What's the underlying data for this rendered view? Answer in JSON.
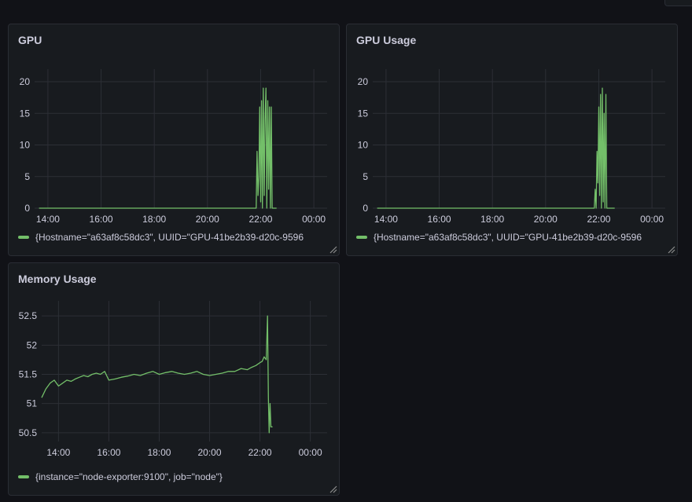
{
  "colors": {
    "series": "#73bf69",
    "grid": "#2c2f36",
    "panel_bg": "#181b1f",
    "page_bg": "#111217"
  },
  "panels": [
    {
      "id": "gpu",
      "title": "GPU",
      "legend": "{Hostname=\"a63af8c58dc3\", UUID=\"GPU-41be2b39-d20c-9596"
    },
    {
      "id": "gpu_usage",
      "title": "GPU Usage",
      "legend": "{Hostname=\"a63af8c58dc3\", UUID=\"GPU-41be2b39-d20c-9596"
    },
    {
      "id": "memory",
      "title": "Memory Usage",
      "legend": "{instance=\"node-exporter:9100\", job=\"node\"}"
    }
  ],
  "chart_data": [
    {
      "type": "line",
      "title": "GPU",
      "xlabel": "",
      "ylabel": "",
      "x_ticks": [
        "14:00",
        "16:00",
        "18:00",
        "20:00",
        "22:00",
        "00:00"
      ],
      "y_ticks": [
        0,
        5,
        10,
        15,
        20
      ],
      "ylim": [
        0,
        21
      ],
      "grid": true,
      "legend_position": "bottom",
      "series": [
        {
          "name": "{Hostname=\"a63af8c58dc3\", UUID=\"GPU-41be2b39-d20c-9596",
          "x": [
            "13:40",
            "21:50",
            "21:52",
            "21:54",
            "21:56",
            "21:58",
            "22:00",
            "22:02",
            "22:04",
            "22:06",
            "22:08",
            "22:10",
            "22:12",
            "22:14",
            "22:16",
            "22:18",
            "22:20",
            "22:22",
            "22:24",
            "22:26",
            "22:28",
            "22:30",
            "22:32",
            "22:34",
            "22:36"
          ],
          "y": [
            0,
            0,
            9,
            2,
            5,
            16,
            1,
            17,
            0,
            19,
            2,
            14,
            19,
            0,
            17,
            3,
            16,
            0,
            16,
            0,
            0,
            0,
            0,
            0,
            0
          ]
        }
      ]
    },
    {
      "type": "line",
      "title": "GPU Usage",
      "xlabel": "",
      "ylabel": "",
      "x_ticks": [
        "14:00",
        "16:00",
        "18:00",
        "20:00",
        "22:00",
        "00:00"
      ],
      "y_ticks": [
        0,
        5,
        10,
        15,
        20
      ],
      "ylim": [
        0,
        21
      ],
      "grid": true,
      "legend_position": "bottom",
      "series": [
        {
          "name": "{Hostname=\"a63af8c58dc3\", UUID=\"GPU-41be2b39-d20c-9596",
          "x": [
            "13:40",
            "21:50",
            "21:52",
            "21:54",
            "21:56",
            "21:58",
            "22:00",
            "22:02",
            "22:04",
            "22:06",
            "22:08",
            "22:10",
            "22:12",
            "22:14",
            "22:16",
            "22:18",
            "22:20",
            "22:22",
            "22:24",
            "22:26",
            "22:28",
            "22:30",
            "22:32",
            "22:34",
            "22:36"
          ],
          "y": [
            0,
            0,
            3,
            0,
            9,
            4,
            16,
            2,
            18,
            0,
            19,
            1,
            15,
            0,
            18,
            0,
            0,
            0,
            0,
            0,
            0,
            0,
            0,
            0,
            0
          ]
        }
      ]
    },
    {
      "type": "line",
      "title": "Memory Usage",
      "xlabel": "",
      "ylabel": "",
      "x_ticks": [
        "14:00",
        "16:00",
        "18:00",
        "20:00",
        "22:00",
        "00:00"
      ],
      "y_ticks": [
        50.5,
        51,
        51.5,
        52,
        52.5
      ],
      "ylim": [
        50.35,
        52.65
      ],
      "grid": true,
      "legend_position": "bottom",
      "series": [
        {
          "name": "{instance=\"node-exporter:9100\", job=\"node\"}",
          "x": [
            "13:20",
            "13:30",
            "13:40",
            "13:50",
            "14:00",
            "14:10",
            "14:20",
            "14:30",
            "14:40",
            "14:50",
            "15:00",
            "15:10",
            "15:20",
            "15:30",
            "15:40",
            "15:50",
            "16:00",
            "16:15",
            "16:30",
            "16:45",
            "17:00",
            "17:15",
            "17:30",
            "17:45",
            "18:00",
            "18:15",
            "18:30",
            "18:45",
            "19:00",
            "19:15",
            "19:30",
            "19:45",
            "20:00",
            "20:15",
            "20:30",
            "20:45",
            "21:00",
            "21:15",
            "21:30",
            "21:40",
            "21:50",
            "22:00",
            "22:05",
            "22:10",
            "22:15",
            "22:18",
            "22:20",
            "22:22",
            "22:24",
            "22:26",
            "22:28",
            "22:30"
          ],
          "y": [
            51.1,
            51.25,
            51.35,
            51.4,
            51.3,
            51.35,
            51.4,
            51.38,
            51.42,
            51.45,
            51.48,
            51.46,
            51.5,
            51.52,
            51.5,
            51.55,
            51.4,
            51.42,
            51.45,
            51.47,
            51.5,
            51.48,
            51.52,
            51.55,
            51.5,
            51.53,
            51.55,
            51.52,
            51.5,
            51.52,
            51.55,
            51.5,
            51.48,
            51.5,
            51.52,
            51.55,
            51.55,
            51.6,
            51.58,
            51.62,
            51.65,
            51.7,
            51.72,
            51.8,
            51.75,
            52.5,
            51.1,
            50.5,
            51.0,
            50.6,
            50.6,
            50.6
          ]
        }
      ]
    }
  ]
}
